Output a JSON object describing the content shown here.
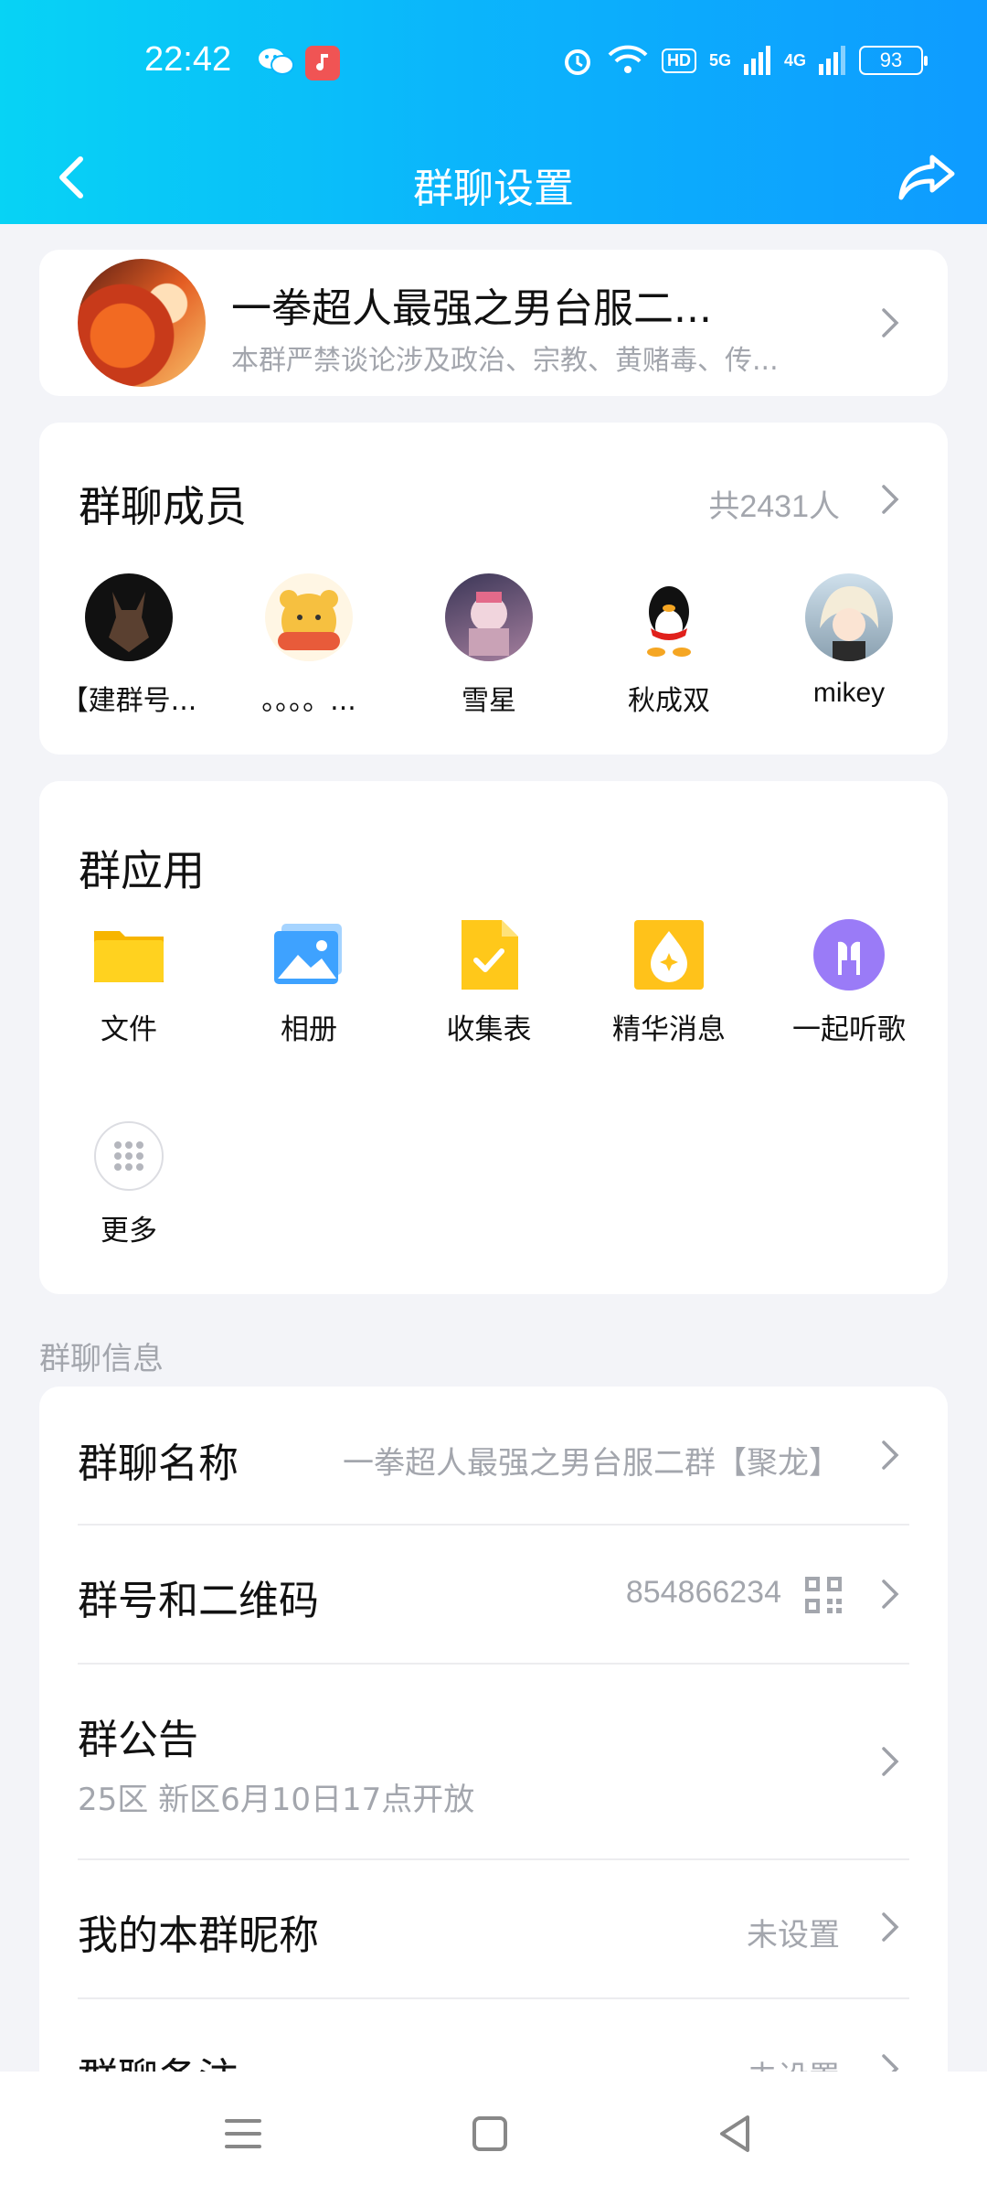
{
  "status_bar": {
    "time": "22:42",
    "hd_badge": "HD",
    "net1": "5G",
    "net2": "4G",
    "battery": "93",
    "icons": [
      "wechat-icon",
      "music-app-icon",
      "alarm-icon",
      "wifi-icon",
      "signal-icon"
    ]
  },
  "nav": {
    "title": "群聊设置",
    "back_icon": "chevron-left-icon",
    "share_icon": "share-icon"
  },
  "group": {
    "name": "一拳超人最强之男台服二...",
    "description": "本群严禁谈论涉及政治、宗教、黄赌毒、传..."
  },
  "members": {
    "title": "群聊成员",
    "count": "共2431人",
    "list": [
      {
        "name": "【建群号..."
      },
      {
        "name": "。。。。..."
      },
      {
        "name": "雪星"
      },
      {
        "name": "秋成双"
      },
      {
        "name": "mikey"
      }
    ]
  },
  "apps": {
    "title": "群应用",
    "items": [
      {
        "label": "文件",
        "icon": "folder-icon"
      },
      {
        "label": "相册",
        "icon": "photo-album-icon"
      },
      {
        "label": "收集表",
        "icon": "form-icon"
      },
      {
        "label": "精华消息",
        "icon": "essence-icon"
      },
      {
        "label": "一起听歌",
        "icon": "headphones-icon"
      },
      {
        "label": "更多",
        "icon": "more-grid-icon"
      }
    ]
  },
  "info": {
    "section_label": "群聊信息",
    "group_name": {
      "title": "群聊名称",
      "value": "一拳超人最强之男台服二群【聚龙】"
    },
    "group_number": {
      "title": "群号和二维码",
      "value": "854866234"
    },
    "announcement": {
      "title": "群公告",
      "value": "25区 新区6月10日17点开放"
    },
    "my_nickname": {
      "title": "我的本群昵称",
      "value": "未设置"
    },
    "remark": {
      "title": "群聊备注",
      "value": "未设置"
    }
  },
  "colors": {
    "header_gradient_start": "#07d3f5",
    "header_gradient_end": "#0e9bff",
    "background": "#f3f4f8",
    "secondary_text": "#a3a6ad"
  }
}
